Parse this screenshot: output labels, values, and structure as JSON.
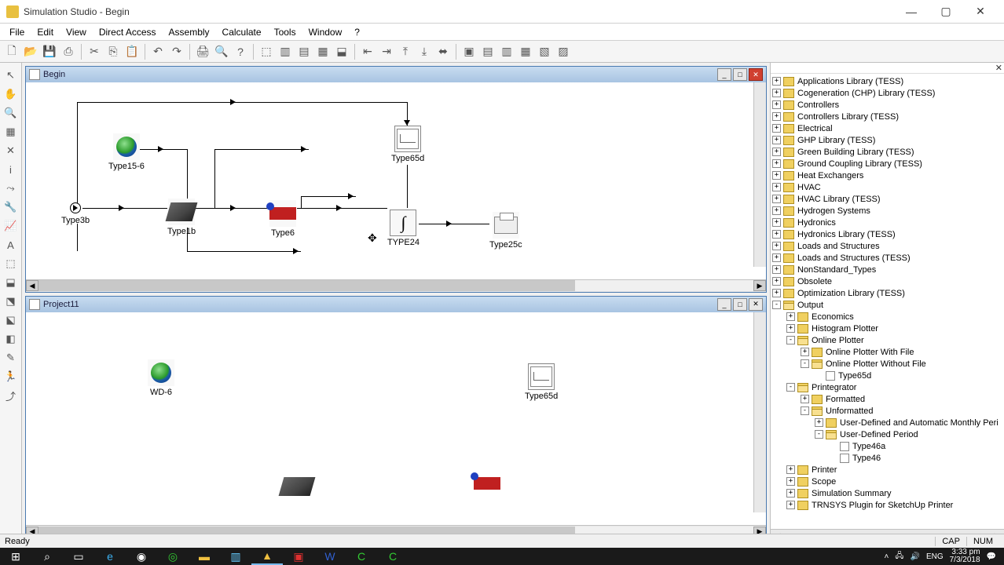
{
  "window": {
    "title": "Simulation Studio - Begin"
  },
  "menu": {
    "file": "File",
    "edit": "Edit",
    "view": "View",
    "direct_access": "Direct Access",
    "assembly": "Assembly",
    "calculate": "Calculate",
    "tools": "Tools",
    "window": "Window",
    "help": "?"
  },
  "subwindows": {
    "begin": {
      "title": "Begin",
      "nodes": {
        "type15_6": "Type15-6",
        "type3b": "Type3b",
        "type1b": "Type1b",
        "type6": "Type6",
        "type65d": "Type65d",
        "type24": "TYPE24",
        "type25c": "Type25c"
      }
    },
    "project11": {
      "title": "Project11",
      "nodes": {
        "wd6": "WD-6",
        "type65d": "Type65d"
      }
    }
  },
  "tree": [
    {
      "d": 0,
      "e": "+",
      "t": "folder",
      "l": "Applications Library (TESS)"
    },
    {
      "d": 0,
      "e": "+",
      "t": "folder",
      "l": "Cogeneration (CHP) Library (TESS)"
    },
    {
      "d": 0,
      "e": "+",
      "t": "folder",
      "l": "Controllers"
    },
    {
      "d": 0,
      "e": "+",
      "t": "folder",
      "l": "Controllers Library (TESS)"
    },
    {
      "d": 0,
      "e": "+",
      "t": "folder",
      "l": "Electrical"
    },
    {
      "d": 0,
      "e": "+",
      "t": "folder",
      "l": "GHP Library (TESS)"
    },
    {
      "d": 0,
      "e": "+",
      "t": "folder",
      "l": "Green Building Library (TESS)"
    },
    {
      "d": 0,
      "e": "+",
      "t": "folder",
      "l": "Ground Coupling Library (TESS)"
    },
    {
      "d": 0,
      "e": "+",
      "t": "folder",
      "l": "Heat Exchangers"
    },
    {
      "d": 0,
      "e": "+",
      "t": "folder",
      "l": "HVAC"
    },
    {
      "d": 0,
      "e": "+",
      "t": "folder",
      "l": "HVAC Library (TESS)"
    },
    {
      "d": 0,
      "e": "+",
      "t": "folder",
      "l": "Hydrogen Systems"
    },
    {
      "d": 0,
      "e": "+",
      "t": "folder",
      "l": "Hydronics"
    },
    {
      "d": 0,
      "e": "+",
      "t": "folder",
      "l": "Hydronics Library (TESS)"
    },
    {
      "d": 0,
      "e": "+",
      "t": "folder",
      "l": "Loads and Structures"
    },
    {
      "d": 0,
      "e": "+",
      "t": "folder",
      "l": "Loads and Structures (TESS)"
    },
    {
      "d": 0,
      "e": "+",
      "t": "folder",
      "l": "NonStandard_Types"
    },
    {
      "d": 0,
      "e": "+",
      "t": "folder",
      "l": "Obsolete"
    },
    {
      "d": 0,
      "e": "+",
      "t": "folder",
      "l": "Optimization Library (TESS)"
    },
    {
      "d": 0,
      "e": "-",
      "t": "folder-open",
      "l": "Output"
    },
    {
      "d": 1,
      "e": "+",
      "t": "folder",
      "l": "Economics"
    },
    {
      "d": 1,
      "e": "+",
      "t": "folder",
      "l": "Histogram Plotter"
    },
    {
      "d": 1,
      "e": "-",
      "t": "folder-open",
      "l": "Online Plotter"
    },
    {
      "d": 2,
      "e": "+",
      "t": "folder",
      "l": "Online Plotter With File"
    },
    {
      "d": 2,
      "e": "-",
      "t": "folder-open",
      "l": "Online Plotter Without File"
    },
    {
      "d": 3,
      "e": " ",
      "t": "leaf",
      "l": "Type65d"
    },
    {
      "d": 1,
      "e": "-",
      "t": "folder-open",
      "l": "Printegrator"
    },
    {
      "d": 2,
      "e": "+",
      "t": "folder",
      "l": "Formatted"
    },
    {
      "d": 2,
      "e": "-",
      "t": "folder-open",
      "l": "Unformatted"
    },
    {
      "d": 3,
      "e": "+",
      "t": "folder",
      "l": "User-Defined and Automatic Monthly Peri"
    },
    {
      "d": 3,
      "e": "-",
      "t": "folder-open",
      "l": "User-Defined Period"
    },
    {
      "d": 4,
      "e": " ",
      "t": "leaf",
      "l": "Type46a"
    },
    {
      "d": 4,
      "e": " ",
      "t": "leaf",
      "l": "Type46"
    },
    {
      "d": 1,
      "e": "+",
      "t": "folder",
      "l": "Printer"
    },
    {
      "d": 1,
      "e": "+",
      "t": "folder",
      "l": "Scope"
    },
    {
      "d": 1,
      "e": "+",
      "t": "folder",
      "l": "Simulation Summary"
    },
    {
      "d": 1,
      "e": "+",
      "t": "folder",
      "l": "TRNSYS Plugin for SketchUp Printer"
    }
  ],
  "statusbar": {
    "ready": "Ready",
    "cap": "CAP",
    "num": "NUM"
  },
  "tray": {
    "lang": "ENG",
    "time": "3:33 pm",
    "date": "7/3/2018"
  }
}
